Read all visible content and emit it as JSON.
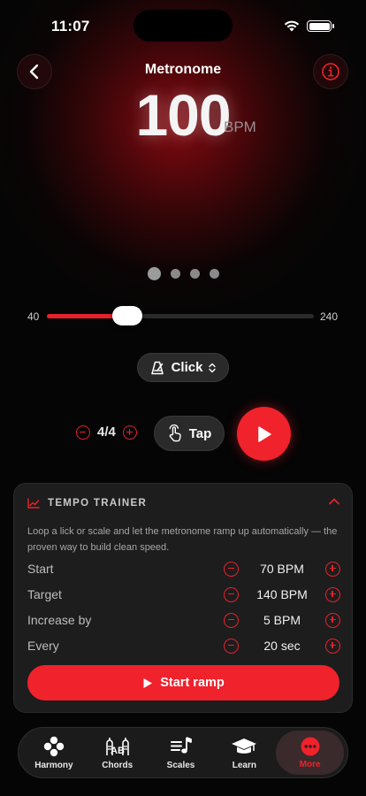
{
  "status": {
    "time": "11:07"
  },
  "header": {
    "title": "Metronome"
  },
  "tempo": {
    "value": "100",
    "unit": "BPM"
  },
  "pager": {
    "count": 4,
    "active": 0
  },
  "slider": {
    "min": "40",
    "max": "240",
    "value": 100
  },
  "sound": {
    "label": "Click"
  },
  "meter": {
    "value": "4/4"
  },
  "tap": {
    "label": "Tap"
  },
  "trainer": {
    "title": "TEMPO TRAINER",
    "description": "Loop a lick or scale and let the metronome ramp up automatically — the proven way to build clean speed.",
    "rows": [
      {
        "label": "Start",
        "value": "70 BPM"
      },
      {
        "label": "Target",
        "value": "140 BPM"
      },
      {
        "label": "Increase by",
        "value": "5 BPM"
      },
      {
        "label": "Every",
        "value": "20 sec"
      }
    ],
    "button": "Start ramp"
  },
  "tabs": [
    {
      "label": "Harmony",
      "icon": "harmony-icon"
    },
    {
      "label": "Chords",
      "icon": "chords-icon"
    },
    {
      "label": "Scales",
      "icon": "scales-icon"
    },
    {
      "label": "Learn",
      "icon": "learn-icon"
    },
    {
      "label": "More",
      "icon": "more-icon"
    }
  ],
  "colors": {
    "accent": "#f0222c",
    "card": "#1d1d1d",
    "background": "#050505"
  }
}
